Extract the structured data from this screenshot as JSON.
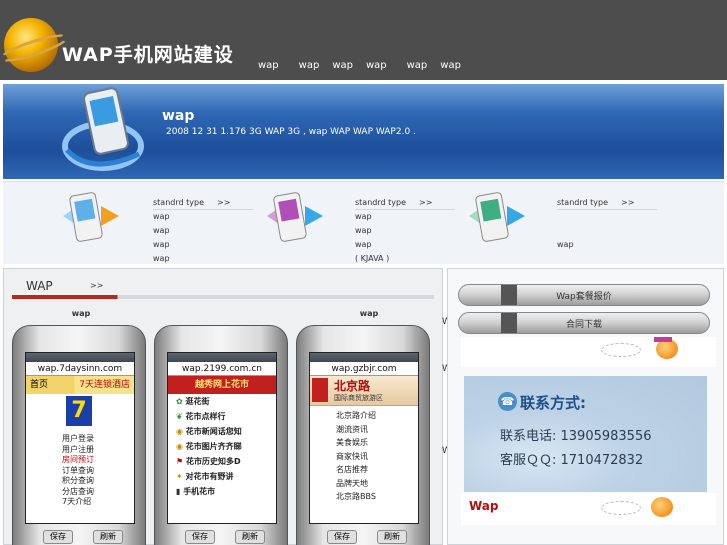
{
  "header": {
    "logo_title": "WAP手机网站建设",
    "nav": [
      "wap",
      "wap",
      "wap",
      "wap",
      "wap",
      "wap"
    ]
  },
  "banner": {
    "title": "wap",
    "text": "2008 12 31        1.176  3G  WAP              3G              ,                wap     WAP     WAP     WAP2.0  ."
  },
  "features": [
    {
      "type": "standrd type",
      "more": ">>",
      "lines": [
        "  wap",
        "wap",
        "wap",
        "wap"
      ]
    },
    {
      "type": "standrd type",
      "more": ">>",
      "lines": [
        "wap",
        "wap",
        "wap",
        "(      KJAVA  )"
      ]
    },
    {
      "type": "standrd type",
      "more": ">>",
      "lines": [
        "wap"
      ]
    }
  ],
  "showcase": {
    "title": "WAP",
    "more": ">>",
    "phones": [
      {
        "label": "wap",
        "url": "wap.7daysinn.com",
        "ad_left": "首页",
        "ad_right": "7天连锁酒店",
        "menu": [
          "用户登录",
          "用户注册",
          "房间预订",
          "订单查询",
          "积分查询",
          "分店查询",
          "7天介绍"
        ],
        "keys": [
          "保存",
          "刷新"
        ]
      },
      {
        "label": "",
        "url": "wap.2199.com.cn",
        "ad": "越秀网上花市",
        "menu": [
          "逛花街",
          "花市点样行",
          "花市新闻话您知",
          "花市图片齐齐睇",
          "花市历史知多D",
          "对花市有野讲",
          "手机花市"
        ],
        "keys": [
          "保存",
          "刷新"
        ]
      },
      {
        "label": "wap",
        "url": "wap.gzbjr.com",
        "ad": "北京路",
        "ad_sub": "国际商贸旅游区",
        "menu": [
          "北京路介绍",
          "潮流资讯",
          "美食娱乐",
          "商家快讯",
          "名店推荐",
          "品牌天地",
          "北京路BBS"
        ],
        "keys": [
          "保存",
          "刷新"
        ]
      }
    ]
  },
  "sidebar": {
    "price_button": "Wap套餐报价",
    "contract_button": "合同下载",
    "contact_title": "联系方式:",
    "phone_label": "联系电话: 13905983556",
    "qq_label": "客服ＱＱ: 1710472832",
    "footer_text": "Wap",
    "side_fragments": [
      "WA",
      "W",
      "W"
    ]
  }
}
